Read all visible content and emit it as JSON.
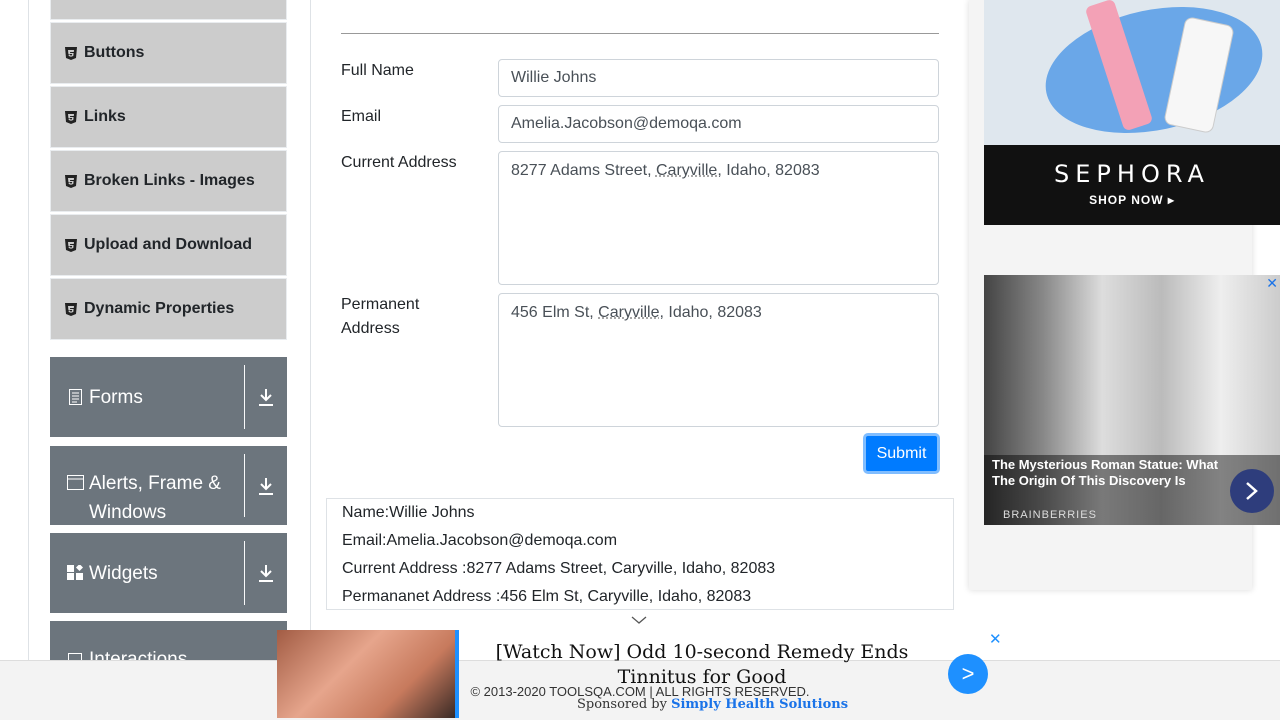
{
  "sidebar": {
    "elements_items": [
      {
        "label": "Buttons"
      },
      {
        "label": "Links"
      },
      {
        "label": "Broken Links - Images"
      },
      {
        "label": "Upload and Download"
      },
      {
        "label": "Dynamic Properties"
      }
    ],
    "groups": [
      {
        "label": "Forms",
        "icon": "form-icon"
      },
      {
        "label": "Alerts, Frame & Windows",
        "icon": "window-icon"
      },
      {
        "label": "Widgets",
        "icon": "widgets-icon"
      },
      {
        "label": "Interactions",
        "icon": "interactions-icon"
      }
    ]
  },
  "form": {
    "full_name_label": "Full Name",
    "full_name_value": "Willie Johns",
    "email_label": "Email",
    "email_value": "Amelia.Jacobson@demoqa.com",
    "current_address_label": "Current Address",
    "current_address_pre": "8277 Adams Street, ",
    "current_address_city": "Caryville",
    "current_address_post": ", Idaho, 82083",
    "permanent_address_label_1": "Permanent",
    "permanent_address_label_2": "Address",
    "permanent_address_pre": "456 Elm St, ",
    "permanent_address_city": "Caryville",
    "permanent_address_post": ", Idaho, 82083",
    "submit_label": "Submit"
  },
  "output": {
    "name": "Name:Willie Johns",
    "email": "Email:Amelia.Jacobson@demoqa.com",
    "current_address": "Current Address :8277 Adams Street, Caryville, Idaho, 82083",
    "permanent_address": "Permananet Address :456 Elm St, Caryville, Idaho, 82083"
  },
  "ads": {
    "sephora_brand": "SEPHORA",
    "sephora_cta": "SHOP NOW ▸",
    "brain_title": "The Mysterious Roman Statue: What The Origin Of This Discovery Is",
    "brain_source": "BRAINBERRIES",
    "bottom_headline": "[Watch Now] Odd 10-second Remedy Ends Tinnitus for Good",
    "bottom_sponsor_prefix": "Sponsored by ",
    "bottom_sponsor_name": "Simply Health Solutions",
    "bottom_go": ">",
    "close_glyph": "✕"
  },
  "footer": {
    "copyright": "© 2013-2020 TOOLSQA.COM | ALL RIGHTS RESERVED."
  },
  "colors": {
    "primary": "#007bff",
    "sidebar_group": "#6c757d",
    "sidebar_item": "#cccccc"
  }
}
